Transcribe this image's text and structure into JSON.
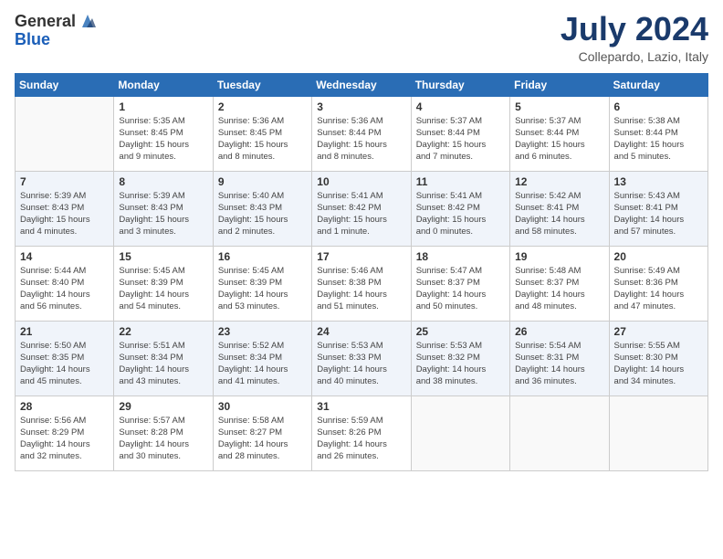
{
  "header": {
    "logo_general": "General",
    "logo_blue": "Blue",
    "title": "July 2024",
    "subtitle": "Collepardo, Lazio, Italy"
  },
  "days_of_week": [
    "Sunday",
    "Monday",
    "Tuesday",
    "Wednesday",
    "Thursday",
    "Friday",
    "Saturday"
  ],
  "weeks": [
    [
      {
        "day": "",
        "info": ""
      },
      {
        "day": "1",
        "info": "Sunrise: 5:35 AM\nSunset: 8:45 PM\nDaylight: 15 hours\nand 9 minutes."
      },
      {
        "day": "2",
        "info": "Sunrise: 5:36 AM\nSunset: 8:45 PM\nDaylight: 15 hours\nand 8 minutes."
      },
      {
        "day": "3",
        "info": "Sunrise: 5:36 AM\nSunset: 8:44 PM\nDaylight: 15 hours\nand 8 minutes."
      },
      {
        "day": "4",
        "info": "Sunrise: 5:37 AM\nSunset: 8:44 PM\nDaylight: 15 hours\nand 7 minutes."
      },
      {
        "day": "5",
        "info": "Sunrise: 5:37 AM\nSunset: 8:44 PM\nDaylight: 15 hours\nand 6 minutes."
      },
      {
        "day": "6",
        "info": "Sunrise: 5:38 AM\nSunset: 8:44 PM\nDaylight: 15 hours\nand 5 minutes."
      }
    ],
    [
      {
        "day": "7",
        "info": "Sunrise: 5:39 AM\nSunset: 8:43 PM\nDaylight: 15 hours\nand 4 minutes."
      },
      {
        "day": "8",
        "info": "Sunrise: 5:39 AM\nSunset: 8:43 PM\nDaylight: 15 hours\nand 3 minutes."
      },
      {
        "day": "9",
        "info": "Sunrise: 5:40 AM\nSunset: 8:43 PM\nDaylight: 15 hours\nand 2 minutes."
      },
      {
        "day": "10",
        "info": "Sunrise: 5:41 AM\nSunset: 8:42 PM\nDaylight: 15 hours\nand 1 minute."
      },
      {
        "day": "11",
        "info": "Sunrise: 5:41 AM\nSunset: 8:42 PM\nDaylight: 15 hours\nand 0 minutes."
      },
      {
        "day": "12",
        "info": "Sunrise: 5:42 AM\nSunset: 8:41 PM\nDaylight: 14 hours\nand 58 minutes."
      },
      {
        "day": "13",
        "info": "Sunrise: 5:43 AM\nSunset: 8:41 PM\nDaylight: 14 hours\nand 57 minutes."
      }
    ],
    [
      {
        "day": "14",
        "info": "Sunrise: 5:44 AM\nSunset: 8:40 PM\nDaylight: 14 hours\nand 56 minutes."
      },
      {
        "day": "15",
        "info": "Sunrise: 5:45 AM\nSunset: 8:39 PM\nDaylight: 14 hours\nand 54 minutes."
      },
      {
        "day": "16",
        "info": "Sunrise: 5:45 AM\nSunset: 8:39 PM\nDaylight: 14 hours\nand 53 minutes."
      },
      {
        "day": "17",
        "info": "Sunrise: 5:46 AM\nSunset: 8:38 PM\nDaylight: 14 hours\nand 51 minutes."
      },
      {
        "day": "18",
        "info": "Sunrise: 5:47 AM\nSunset: 8:37 PM\nDaylight: 14 hours\nand 50 minutes."
      },
      {
        "day": "19",
        "info": "Sunrise: 5:48 AM\nSunset: 8:37 PM\nDaylight: 14 hours\nand 48 minutes."
      },
      {
        "day": "20",
        "info": "Sunrise: 5:49 AM\nSunset: 8:36 PM\nDaylight: 14 hours\nand 47 minutes."
      }
    ],
    [
      {
        "day": "21",
        "info": "Sunrise: 5:50 AM\nSunset: 8:35 PM\nDaylight: 14 hours\nand 45 minutes."
      },
      {
        "day": "22",
        "info": "Sunrise: 5:51 AM\nSunset: 8:34 PM\nDaylight: 14 hours\nand 43 minutes."
      },
      {
        "day": "23",
        "info": "Sunrise: 5:52 AM\nSunset: 8:34 PM\nDaylight: 14 hours\nand 41 minutes."
      },
      {
        "day": "24",
        "info": "Sunrise: 5:53 AM\nSunset: 8:33 PM\nDaylight: 14 hours\nand 40 minutes."
      },
      {
        "day": "25",
        "info": "Sunrise: 5:53 AM\nSunset: 8:32 PM\nDaylight: 14 hours\nand 38 minutes."
      },
      {
        "day": "26",
        "info": "Sunrise: 5:54 AM\nSunset: 8:31 PM\nDaylight: 14 hours\nand 36 minutes."
      },
      {
        "day": "27",
        "info": "Sunrise: 5:55 AM\nSunset: 8:30 PM\nDaylight: 14 hours\nand 34 minutes."
      }
    ],
    [
      {
        "day": "28",
        "info": "Sunrise: 5:56 AM\nSunset: 8:29 PM\nDaylight: 14 hours\nand 32 minutes."
      },
      {
        "day": "29",
        "info": "Sunrise: 5:57 AM\nSunset: 8:28 PM\nDaylight: 14 hours\nand 30 minutes."
      },
      {
        "day": "30",
        "info": "Sunrise: 5:58 AM\nSunset: 8:27 PM\nDaylight: 14 hours\nand 28 minutes."
      },
      {
        "day": "31",
        "info": "Sunrise: 5:59 AM\nSunset: 8:26 PM\nDaylight: 14 hours\nand 26 minutes."
      },
      {
        "day": "",
        "info": ""
      },
      {
        "day": "",
        "info": ""
      },
      {
        "day": "",
        "info": ""
      }
    ]
  ]
}
